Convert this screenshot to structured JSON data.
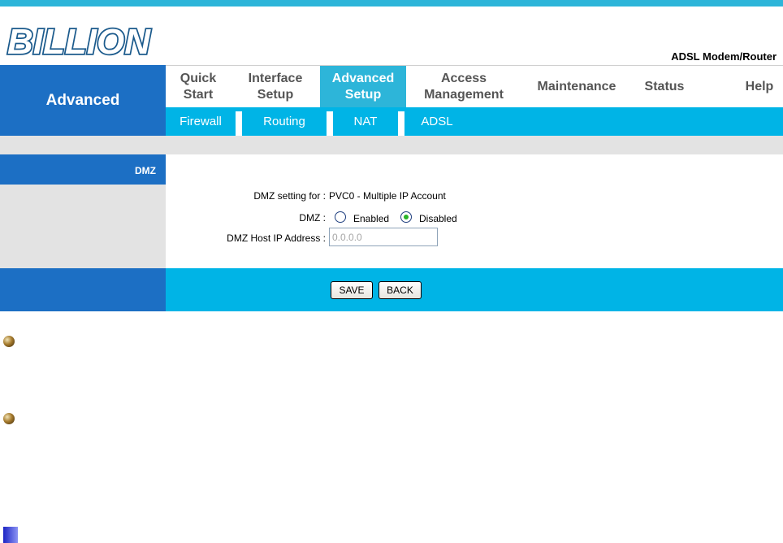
{
  "header": {
    "brand": "BILLION",
    "model": "ADSL Modem/Router",
    "section": "Advanced"
  },
  "menu": [
    {
      "label": "Quick\nStart",
      "active": false
    },
    {
      "label": "Interface\nSetup",
      "active": false
    },
    {
      "label": "Advanced\nSetup",
      "active": true
    },
    {
      "label": "Access\nManagement",
      "active": false
    },
    {
      "label": "Maintenance",
      "active": false
    },
    {
      "label": "Status",
      "active": false
    },
    {
      "label": "Help",
      "active": false
    }
  ],
  "submenu": [
    "Firewall",
    "Routing",
    "NAT",
    "ADSL"
  ],
  "dmz": {
    "section_title": "DMZ",
    "setting_for_label": "DMZ setting for :",
    "setting_for_value": "PVC0 - Multiple IP Account",
    "dmz_label": "DMZ :",
    "enabled_label": "Enabled",
    "disabled_label": "Disabled",
    "selected": "Disabled",
    "host_ip_label": "DMZ Host IP Address :",
    "host_ip_value": "0.0.0.0"
  },
  "buttons": {
    "save": "SAVE",
    "back": "BACK"
  },
  "colors": {
    "accent_blue": "#1c6fc4",
    "accent_cyan": "#00b4e6",
    "panel_gray": "#e3e3e3"
  }
}
